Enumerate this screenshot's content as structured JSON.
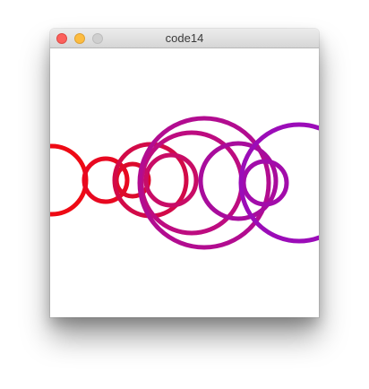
{
  "window": {
    "title": "code14",
    "controls": [
      "close-icon",
      "minimize-icon",
      "maximize-icon"
    ],
    "colors": {
      "close": "#fc605c",
      "minimize": "#fdbc40",
      "maximize": "#cfcfcf",
      "canvas_background": "#ffffff"
    }
  },
  "sketch": {
    "shape": "circle",
    "fill": "none",
    "stroke_gradient": [
      "#ee0a14",
      "#9b0cb8"
    ],
    "circle_count": 10
  }
}
